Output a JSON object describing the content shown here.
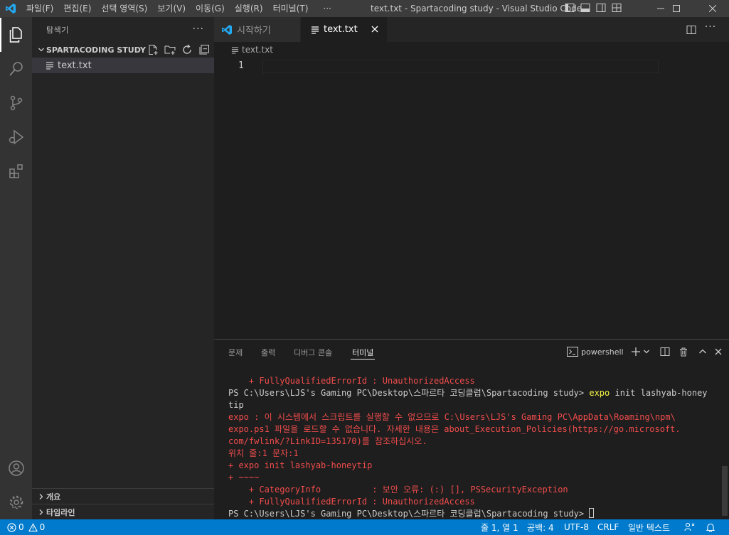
{
  "window": {
    "title": "text.txt - Spartacoding study - Visual Studio Code..."
  },
  "menu": {
    "items": [
      "파일(F)",
      "편집(E)",
      "선택 영역(S)",
      "보기(V)",
      "이동(G)",
      "실행(R)",
      "터미널(T)",
      "···"
    ]
  },
  "sidebar": {
    "header": "탐색기",
    "more": "···",
    "section": "SPARTACODING STUDY",
    "files": [
      "text.txt"
    ],
    "outline": "개요",
    "timeline": "타임라인"
  },
  "tabs": {
    "welcome": "시작하기",
    "active": "text.txt"
  },
  "breadcrumb": "text.txt",
  "editor": {
    "line_number": "1"
  },
  "panel": {
    "tabs": [
      "문제",
      "출력",
      "디버그 콘솔",
      "터미널"
    ],
    "shell": "powershell"
  },
  "terminal": {
    "l1": "    + FullyQualifiedErrorId : UnauthorizedAccess",
    "l2_prompt": "PS C:\\Users\\LJS's Gaming PC\\Desktop\\스파르타 코딩클럽\\Spartacoding study> ",
    "l2_cmd": "expo",
    "l2_rest": " init lashyab-honey",
    "l3": "tip",
    "l4": "expo : 이 시스템에서 스크립트를 실행할 수 없으므로 C:\\Users\\LJS's Gaming PC\\AppData\\Roaming\\npm\\",
    "l5": "expo.ps1 파일을 로드할 수 없습니다. 자세한 내용은 about_Execution_Policies(https://go.microsoft.",
    "l6": "com/fwlink/?LinkID=135170)를 참조하십시오.",
    "l7": "위치 줄:1 문자:1",
    "l8": "+ expo init lashyab-honeytip",
    "l9": "+ ~~~~",
    "l10": "    + CategoryInfo          : 보안 오류: (:) [], PSSecurityException",
    "l11": "    + FullyQualifiedErrorId : UnauthorizedAccess",
    "l12_prompt": "PS C:\\Users\\LJS's Gaming PC\\Desktop\\스파르타 코딩클럽\\Spartacoding study> "
  },
  "status": {
    "errors": "0",
    "warnings": "0",
    "position": "줄 1, 열 1",
    "spaces": "공백: 4",
    "encoding": "UTF-8",
    "eol": "CRLF",
    "language": "일반 텍스트"
  },
  "colors": {
    "statusbar": "#007acc",
    "error_text": "#f14c4c",
    "command_highlight": "#f5f543",
    "vscode_blue": "#23a9f2"
  }
}
